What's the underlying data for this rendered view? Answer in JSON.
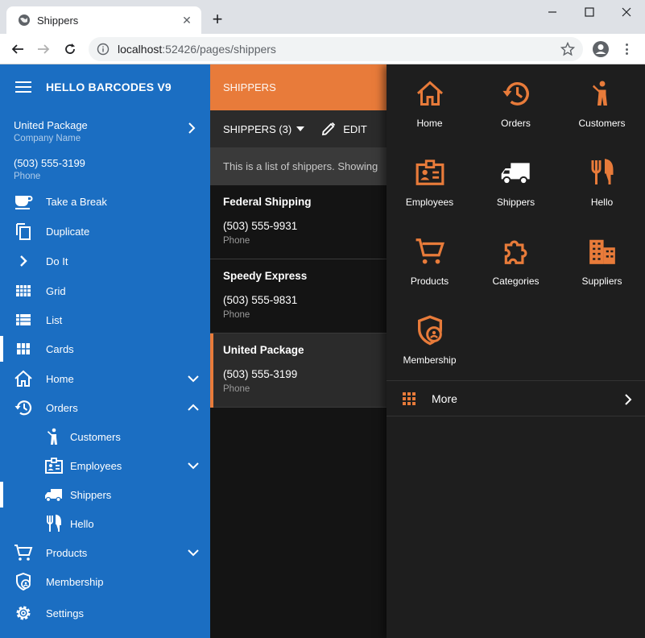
{
  "browser": {
    "tab_title": "Shippers",
    "url_host": "localhost",
    "url_rest": ":52426/pages/shippers"
  },
  "sidebar": {
    "title": "HELLO BARCODES V9",
    "context": [
      {
        "value": "United Package",
        "label": "Company Name"
      },
      {
        "value": "(503) 555-3199",
        "label": "Phone"
      }
    ],
    "items": [
      {
        "label": "Take a Break",
        "icon": "coffee-icon"
      },
      {
        "label": "Duplicate",
        "icon": "duplicate-icon"
      },
      {
        "label": "Do It",
        "icon": "chevron-right-icon"
      },
      {
        "label": "Grid",
        "icon": "grid-icon"
      },
      {
        "label": "List",
        "icon": "list-icon"
      },
      {
        "label": "Cards",
        "icon": "cards-icon"
      },
      {
        "label": "Home",
        "icon": "home-icon"
      },
      {
        "label": "Orders",
        "icon": "history-icon"
      },
      {
        "label": "Customers",
        "icon": "person-icon"
      },
      {
        "label": "Employees",
        "icon": "badge-icon"
      },
      {
        "label": "Shippers",
        "icon": "truck-icon"
      },
      {
        "label": "Hello",
        "icon": "restaurant-icon"
      },
      {
        "label": "Products",
        "icon": "cart-icon"
      },
      {
        "label": "Membership",
        "icon": "shield-icon"
      },
      {
        "label": "Settings",
        "icon": "gear-icon"
      }
    ]
  },
  "main": {
    "header": "SHIPPERS",
    "toolbar": {
      "selector": "SHIPPERS (3)",
      "edit": "EDIT"
    },
    "info": "This is a list of shippers. Showing",
    "records": [
      {
        "name": "Federal Shipping",
        "phone": "(503) 555-9931",
        "phone_label": "Phone"
      },
      {
        "name": "Speedy Express",
        "phone": "(503) 555-9831",
        "phone_label": "Phone"
      },
      {
        "name": "United Package",
        "phone": "(503) 555-3199",
        "phone_label": "Phone"
      }
    ]
  },
  "panel": {
    "tiles": [
      {
        "label": "Home",
        "icon": "home-icon"
      },
      {
        "label": "Orders",
        "icon": "history-icon"
      },
      {
        "label": "Customers",
        "icon": "person-icon"
      },
      {
        "label": "Employees",
        "icon": "badge-icon"
      },
      {
        "label": "Shippers",
        "icon": "truck-icon"
      },
      {
        "label": "Hello",
        "icon": "restaurant-icon"
      },
      {
        "label": "Products",
        "icon": "cart-icon"
      },
      {
        "label": "Categories",
        "icon": "puzzle-icon"
      },
      {
        "label": "Suppliers",
        "icon": "building-icon"
      },
      {
        "label": "Membership",
        "icon": "shield-icon"
      }
    ],
    "more": "More"
  },
  "colors": {
    "accent": "#e87b3a",
    "sidebar": "#1b6ec2",
    "panel": "#1e1e1e"
  }
}
